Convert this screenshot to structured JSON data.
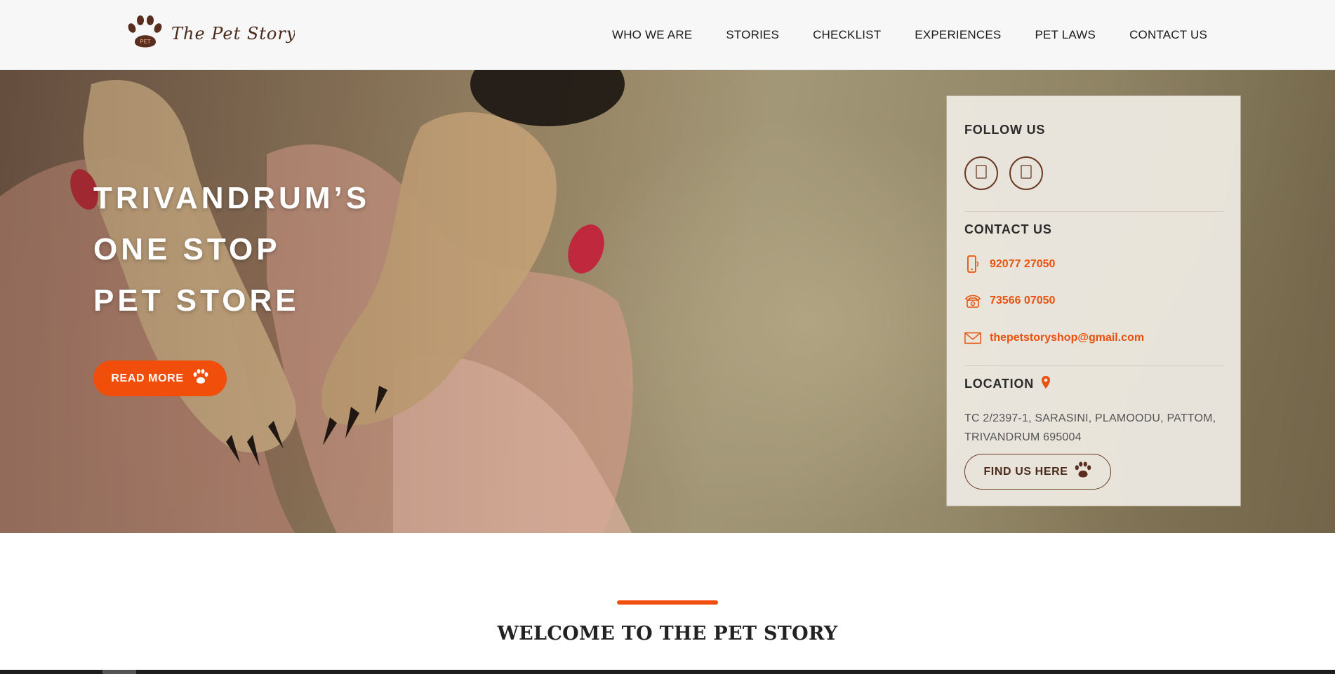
{
  "brand": {
    "logo_text": "The Pet Story",
    "logo_badge": "PET"
  },
  "nav": {
    "items": [
      {
        "label": "WHO WE ARE"
      },
      {
        "label": "STORIES"
      },
      {
        "label": "CHECKLIST"
      },
      {
        "label": "EXPERIENCES"
      },
      {
        "label": "PET LAWS"
      },
      {
        "label": "CONTACT US"
      }
    ]
  },
  "hero": {
    "headline": [
      "TRIVANDRUM’S",
      "ONE STOP",
      "PET STORE"
    ],
    "cta_label": "READ MORE"
  },
  "card": {
    "follow_title": "FOLLOW US",
    "socials": [
      {
        "icon": "facebook-icon",
        "glyph": ""
      },
      {
        "icon": "instagram-icon",
        "glyph": ""
      }
    ],
    "contact_title": "CONTACT US",
    "mobile": "92077 27050",
    "phone": "73566 07050",
    "email": "thepetstoryshop@gmail.com",
    "location_title": "LOCATION",
    "address": "TC 2/2397-1, SARASINI, PLAMOODU, PATTOM, TRIVANDRUM 695004",
    "find_label": "FIND US HERE"
  },
  "welcome": {
    "title": "WELCOME TO THE PET STORY"
  },
  "colors": {
    "accent": "#f24e0b",
    "brown": "#6a3a25",
    "header_bg": "#f7f7f7"
  }
}
